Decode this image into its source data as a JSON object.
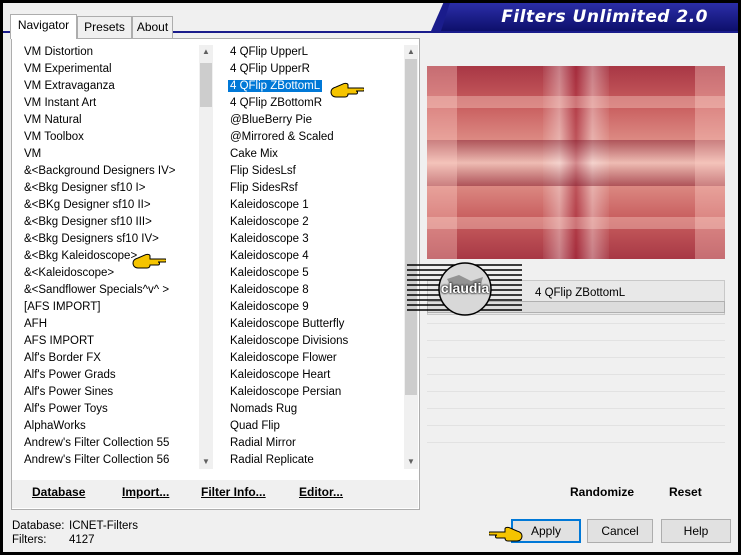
{
  "title": "Filters Unlimited 2.0",
  "tabs": [
    "Navigator",
    "Presets",
    "About"
  ],
  "categories": [
    "VM Distortion",
    "VM Experimental",
    "VM Extravaganza",
    "VM Instant Art",
    "VM Natural",
    "VM Toolbox",
    "VM",
    "&<Background Designers IV>",
    "&<Bkg Designer sf10 I>",
    "&<BKg Designer sf10 II>",
    "&<Bkg Designer sf10 III>",
    "&<Bkg Designers sf10 IV>",
    "&<Bkg Kaleidoscope>",
    "&<Kaleidoscope>",
    "&<Sandflower Specials^v^ >",
    "[AFS IMPORT]",
    "AFH",
    "AFS IMPORT",
    "Alf's Border FX",
    "Alf's Power Grads",
    "Alf's Power Sines",
    "Alf's Power Toys",
    "AlphaWorks",
    "Andrew's Filter Collection 55",
    "Andrew's Filter Collection 56"
  ],
  "filters": [
    "4 QFlip UpperL",
    "4 QFlip UpperR",
    "4 QFlip ZBottomL",
    "4 QFlip ZBottomR",
    "@BlueBerry Pie",
    "@Mirrored & Scaled",
    "Cake Mix",
    "Flip SidesLsf",
    "Flip SidesRsf",
    "Kaleidoscope 1",
    "Kaleidoscope 2",
    "Kaleidoscope 3",
    "Kaleidoscope 4",
    "Kaleidoscope 5",
    "Kaleidoscope 8",
    "Kaleidoscope 9",
    "Kaleidoscope Butterfly",
    "Kaleidoscope Divisions",
    "Kaleidoscope Flower",
    "Kaleidoscope Heart",
    "Kaleidoscope Persian",
    "Nomads Rug",
    "Quad Flip",
    "Radial Mirror",
    "Radial Replicate"
  ],
  "selected_filter": "4 QFlip ZBottomL",
  "watermark": "claudia",
  "bottom_links": {
    "database": "Database",
    "import": "Import...",
    "filter_info": "Filter Info...",
    "editor": "Editor...",
    "randomize": "Randomize",
    "reset": "Reset"
  },
  "info": {
    "database_label": "Database:",
    "database_value": "ICNET-Filters",
    "filters_label": "Filters:",
    "filters_value": "4127"
  },
  "buttons": {
    "apply": "Apply",
    "cancel": "Cancel",
    "help": "Help"
  },
  "colors": {
    "selection": "#0078d7",
    "banner": "#1a1c8c",
    "pointer": "#f5c400"
  }
}
